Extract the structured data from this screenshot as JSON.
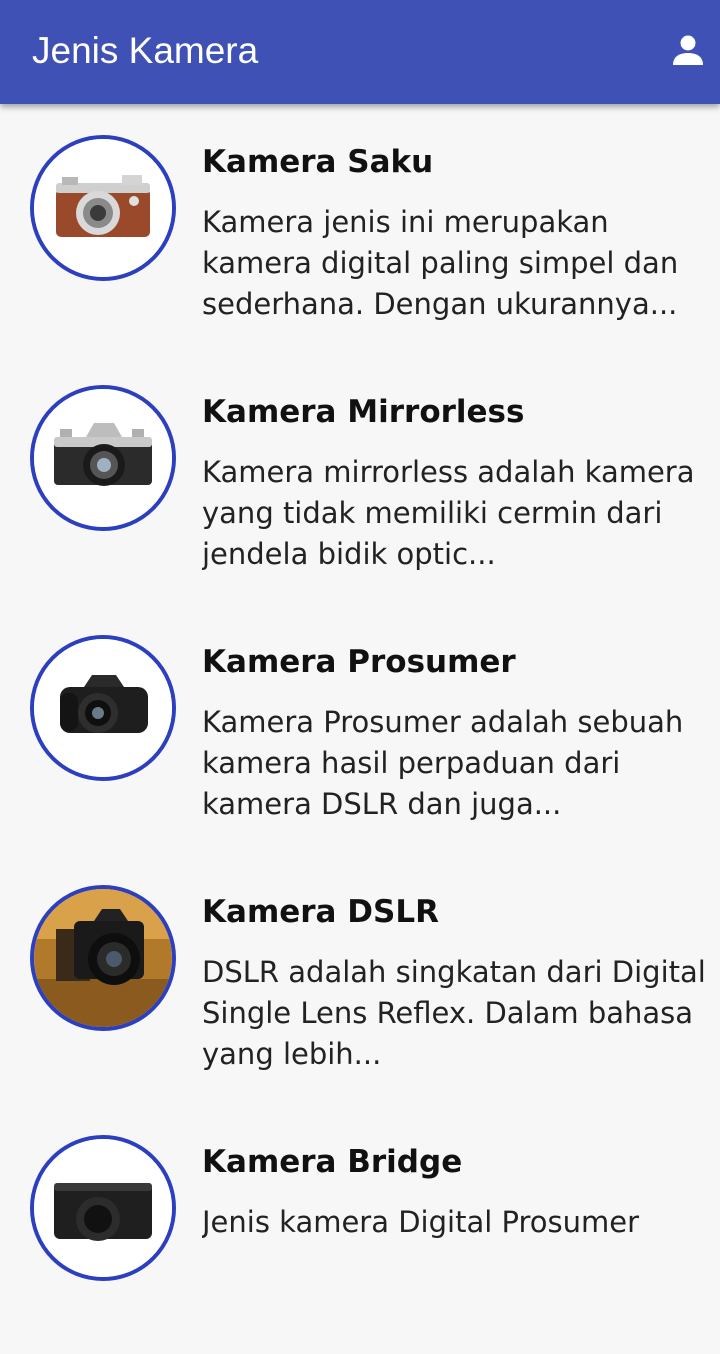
{
  "appbar": {
    "title": "Jenis Kamera",
    "background": "#3f51b5",
    "action_icon": "person-icon"
  },
  "items": [
    {
      "name": "Kamera Saku",
      "description": "Kamera jenis ini merupakan kamera digital paling simpel dan sederhana. Dengan ukurannya...",
      "icon": "pocket-camera-image"
    },
    {
      "name": "Kamera Mirrorless",
      "description": "Kamera mirrorless adalah kamera yang tidak memiliki cermin dari jendela bidik optic...",
      "icon": "mirrorless-camera-image"
    },
    {
      "name": "Kamera Prosumer",
      "description": "Kamera Prosumer adalah sebuah kamera hasil perpaduan dari kamera DSLR dan juga...",
      "icon": "prosumer-camera-image"
    },
    {
      "name": "Kamera DSLR",
      "description": "DSLR adalah singkatan dari Digital Single Lens Reflex. Dalam bahasa yang lebih...",
      "icon": "dslr-camera-image"
    },
    {
      "name": "Kamera Bridge",
      "description": "Jenis kamera Digital Prosumer",
      "icon": "bridge-camera-image"
    }
  ],
  "colors": {
    "accent": "#3f51b5",
    "avatar_border": "#2c3fbf",
    "background": "#f7f7f7"
  }
}
